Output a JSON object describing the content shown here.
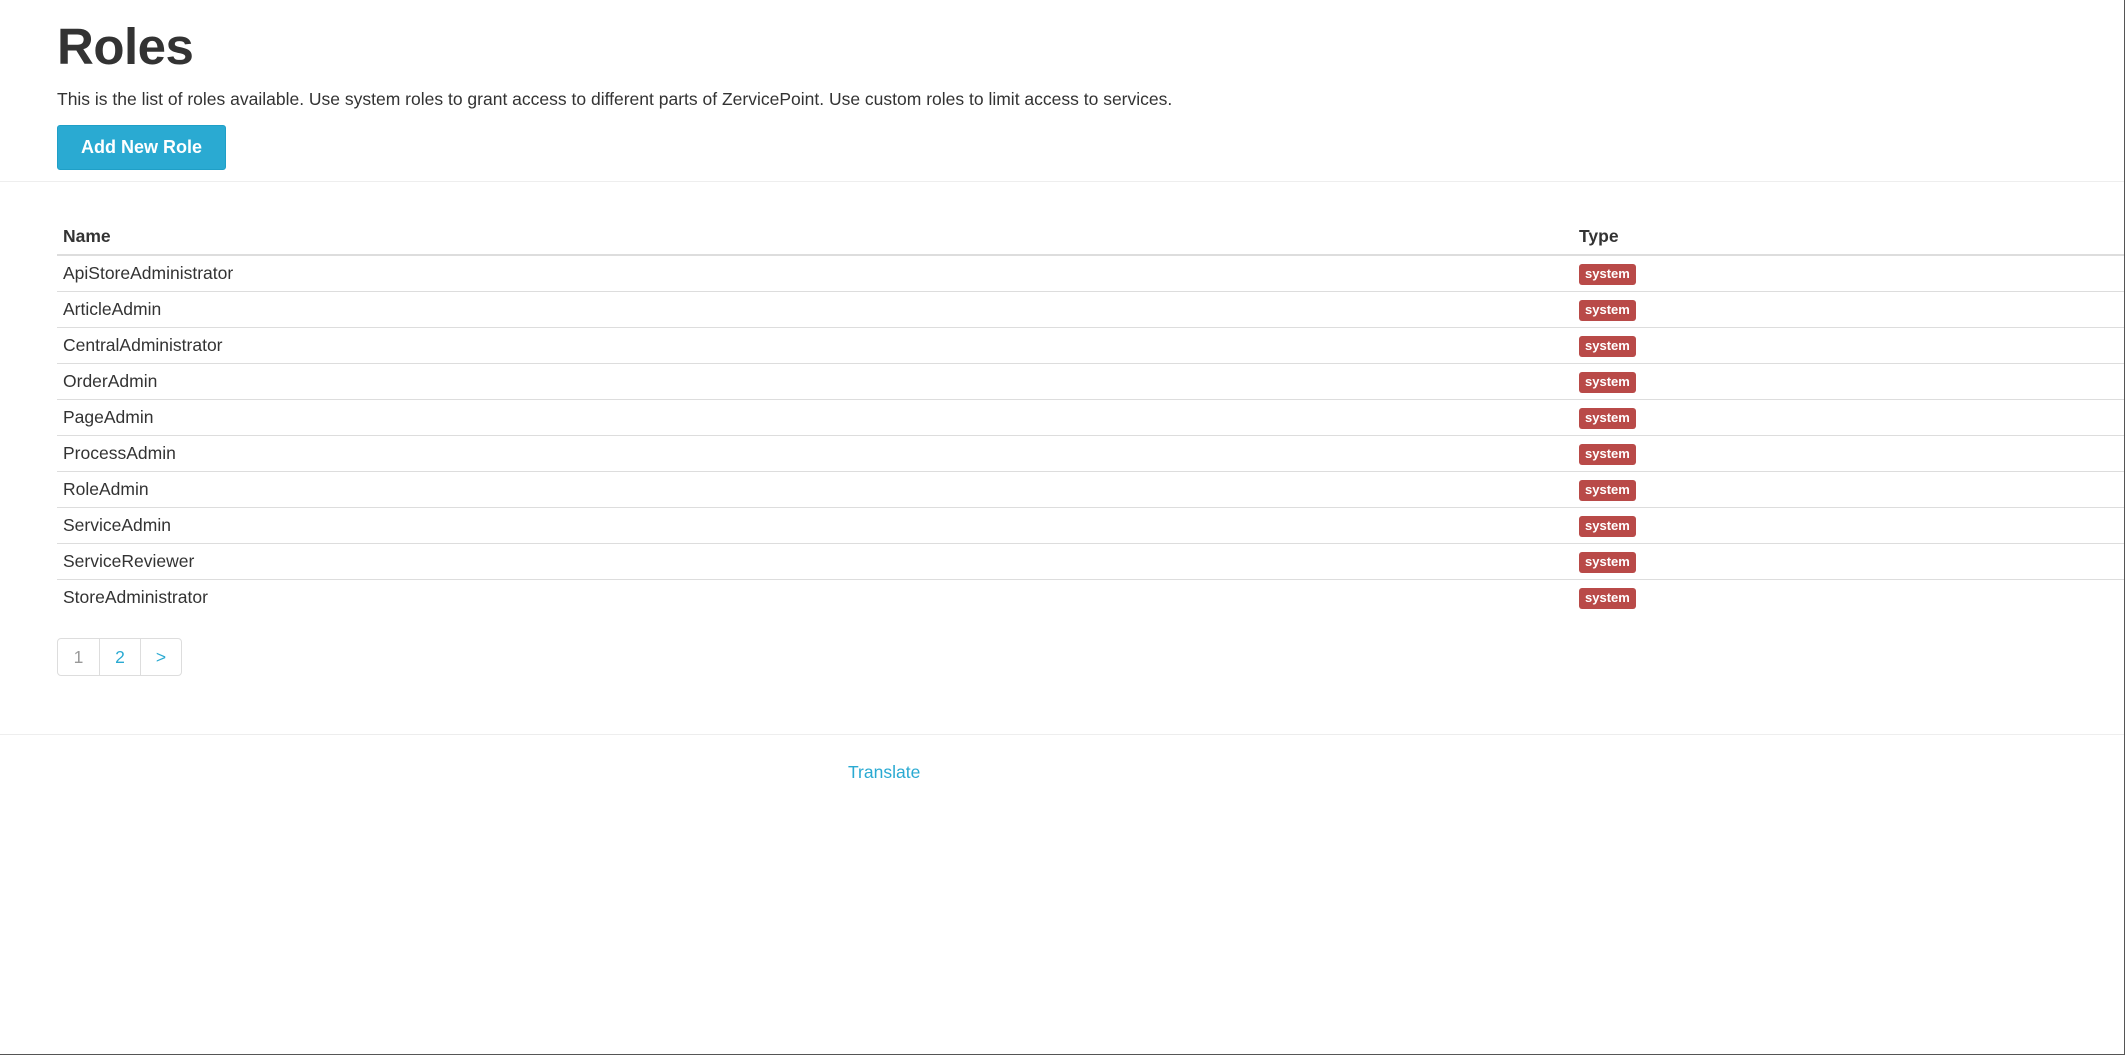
{
  "header": {
    "title": "Roles",
    "description": "This is the list of roles available. Use system roles to grant access to different parts of ZervicePoint. Use custom roles to limit access to services.",
    "add_button_label": "Add New Role"
  },
  "table": {
    "columns": [
      "Name",
      "Type"
    ],
    "rows": [
      {
        "name": "ApiStoreAdministrator",
        "type": "system"
      },
      {
        "name": "ArticleAdmin",
        "type": "system"
      },
      {
        "name": "CentralAdministrator",
        "type": "system"
      },
      {
        "name": "OrderAdmin",
        "type": "system"
      },
      {
        "name": "PageAdmin",
        "type": "system"
      },
      {
        "name": "ProcessAdmin",
        "type": "system"
      },
      {
        "name": "RoleAdmin",
        "type": "system"
      },
      {
        "name": "ServiceAdmin",
        "type": "system"
      },
      {
        "name": "ServiceReviewer",
        "type": "system"
      },
      {
        "name": "StoreAdministrator",
        "type": "system"
      }
    ]
  },
  "pagination": {
    "items": [
      "1",
      "2",
      ">"
    ],
    "current": "1"
  },
  "footer": {
    "translate_label": "Translate"
  },
  "colors": {
    "accent": "#2aaad2",
    "system_badge": "#b94a48",
    "text": "#333333",
    "border": "#dddddd"
  }
}
